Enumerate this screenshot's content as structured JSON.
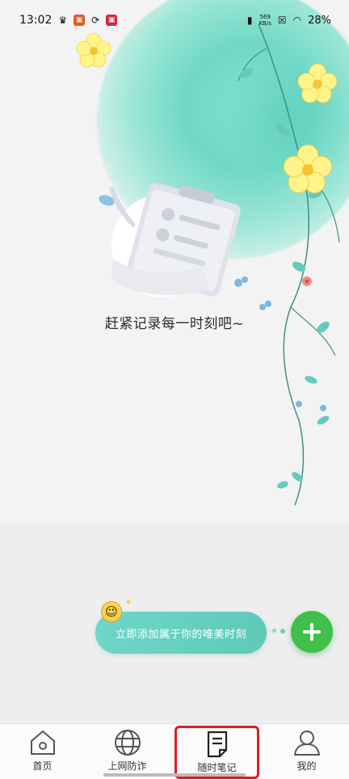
{
  "status_bar": {
    "time": "13:02",
    "net_speed_value": "569",
    "net_speed_unit": "KB/s",
    "battery": "28%"
  },
  "empty_state": {
    "message": "赶紧记录每一时刻吧~"
  },
  "cta": {
    "label": "立即添加属于你的唯美时刻"
  },
  "tabs": [
    {
      "label": "首页",
      "icon": "home-icon",
      "active": false
    },
    {
      "label": "上网防诈",
      "icon": "globe-icon",
      "active": false
    },
    {
      "label": "随时笔记",
      "icon": "note-icon",
      "active": true
    },
    {
      "label": "我的",
      "icon": "person-icon",
      "active": false
    }
  ],
  "colors": {
    "accent_green": "#3fc04a",
    "cta_teal": "#5ecab8",
    "active_outline": "#e01b24"
  }
}
